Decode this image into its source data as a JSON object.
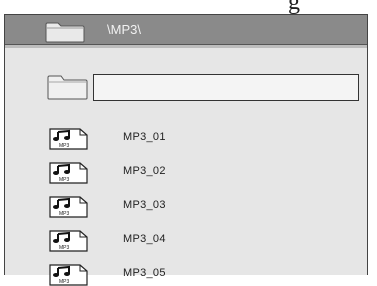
{
  "top_glyphs": "g g",
  "header": {
    "path": "\\MP3\\",
    "folder_icon": "folder-icon"
  },
  "list": {
    "parent_folder_icon": "folder-icon",
    "selected_row_label": "",
    "file_icon": "mp3-file-icon",
    "file_icon_text": "MP3",
    "files": [
      {
        "label": "MP3_01"
      },
      {
        "label": "MP3_02"
      },
      {
        "label": "MP3_03"
      },
      {
        "label": "MP3_04"
      },
      {
        "label": "MP3_05"
      }
    ]
  },
  "colors": {
    "header_bg": "#8a8a8a",
    "panel_bg": "#e6e6e6",
    "selection_bg": "#f4f4f4"
  }
}
